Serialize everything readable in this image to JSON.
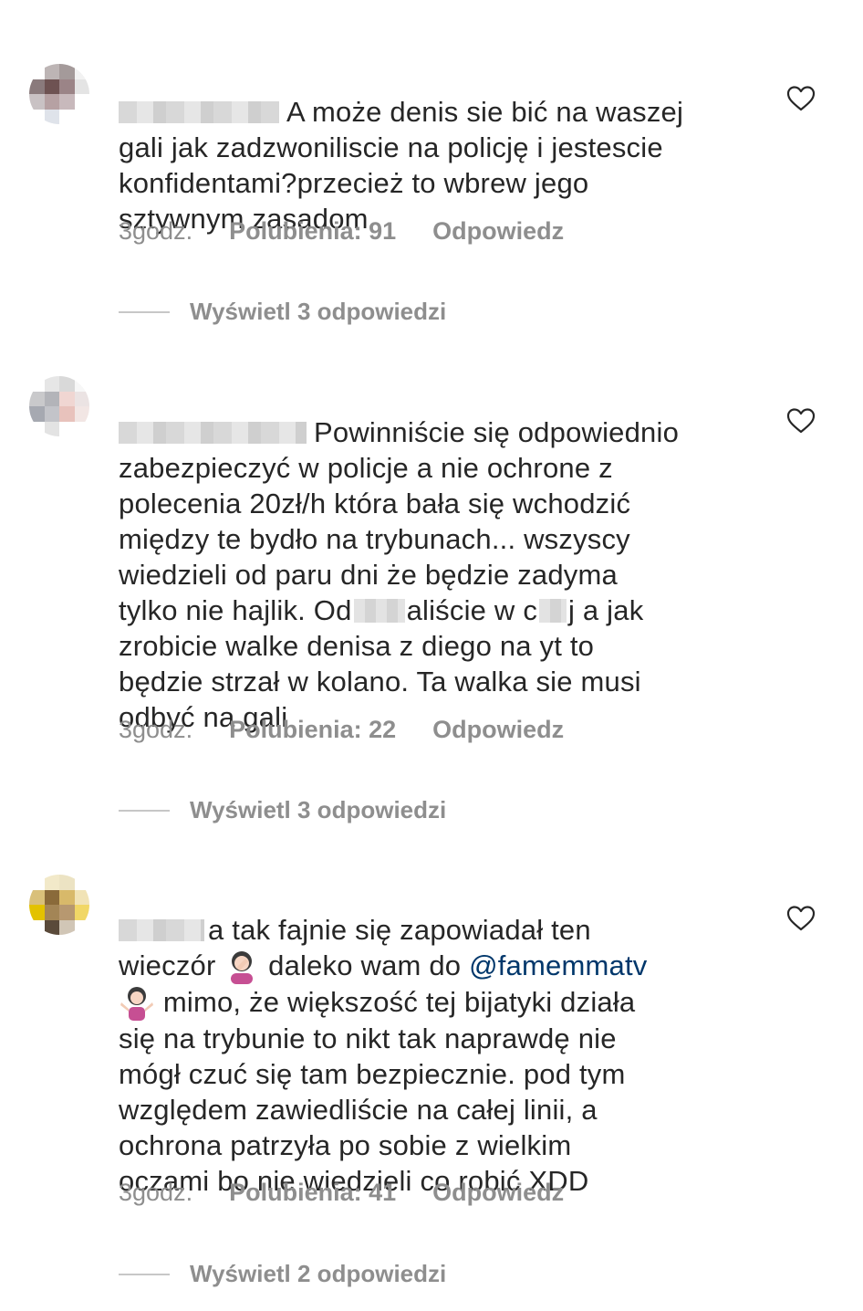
{
  "comments": [
    {
      "text_lines": [
        "A może denis sie bić na waszej",
        "gali jak zadzwoniliscie na policję i jestescie",
        "konfidentami?przecież to wbrew jego",
        "sztywnym zasadom"
      ],
      "time": "3godz.",
      "likes": "Polubienia: 91",
      "reply": "Odpowiedz",
      "view_replies": "Wyświetl 3 odpowiedzi",
      "avatar_colors": [
        "#ffffff",
        "#bdb5b5",
        "#a49a9a",
        "#f2f2f2",
        "#8a7a7c",
        "#6e5252",
        "#9b8487",
        "#e4e4e4",
        "#c9c2c4",
        "#b6a1a3",
        "#c8b9bc",
        "#ffffff",
        "#ffffff",
        "#dfe3ea",
        "#ffffff",
        "#ffffff"
      ]
    },
    {
      "text_lines": [
        "Powinniście się odpowiednio",
        "zabezpieczyć w policje a nie ochrone z",
        "polecenia 20zł/h która bała się wchodzić",
        "między te bydło na trybunach... wszyscy",
        "wiedzieli od paru dni że będzie zadyma",
        "tylko nie hajlik. Od",
        "aliście w c",
        "j a jak",
        "zrobicie walke denisa z diego na yt to",
        "będzie strzał w kolano. Ta walka sie musi",
        "odbyć na gali"
      ],
      "time": "3godz.",
      "likes": "Polubienia: 22",
      "reply": "Odpowiedz",
      "view_replies": "Wyświetl 3 odpowiedzi",
      "avatar_colors": [
        "#ffffff",
        "#e6e6e6",
        "#d9d9d9",
        "#f7f7f7",
        "#c9c9cb",
        "#b3b4b9",
        "#f0d6d2",
        "#ebe3e3",
        "#a6a9b1",
        "#c3c4c9",
        "#e8c2bc",
        "#f2e6e4",
        "#ffffff",
        "#e3e3e3",
        "#ffffff",
        "#ffffff"
      ]
    },
    {
      "text_lines": [
        "a tak fajnie się zapowiadał ten",
        "wieczór",
        "daleko wam do",
        "@famemmatv",
        "mimo, że większość tej bijatyki działa",
        "się na trybunie to nikt tak naprawdę nie",
        "mógł czuć się tam bezpiecznie. pod tym",
        "względem zawiedliście na całej linii, a",
        "ochrona patrzyła po sobie z wielkim",
        "oczami bo nie wiedzieli co robić XDD"
      ],
      "time": "3godz.",
      "likes": "Polubienia: 41",
      "reply": "Odpowiedz",
      "view_replies": "Wyświetl 2 odpowiedzi",
      "avatar_colors": [
        "#ffffff",
        "#f2e9c9",
        "#ece3c3",
        "#ffffff",
        "#d9c07a",
        "#8a6a3a",
        "#d8b96a",
        "#f1e3b6",
        "#e3c200",
        "#a38556",
        "#b79870",
        "#f1d766",
        "#ffffff",
        "#5a4a3a",
        "#d1c6b6",
        "#ffffff"
      ]
    }
  ],
  "icons": {
    "heart": "heart-outline-icon",
    "emoji_facepalm": "woman-facepalming-emoji",
    "emoji_shrug": "woman-shrugging-emoji"
  }
}
